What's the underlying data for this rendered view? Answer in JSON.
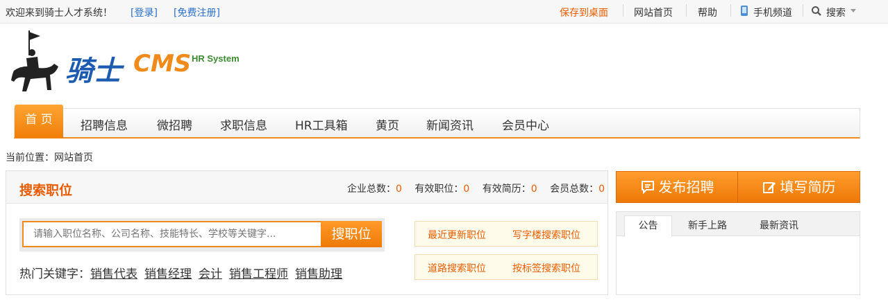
{
  "topbar": {
    "welcome": "欢迎来到骑士人才系统！",
    "login": "[登录]",
    "register": "[免费注册]",
    "save_desktop": "保存到桌面",
    "home": "网站首页",
    "help": "帮助",
    "mobile": "手机频道",
    "search": "搜索"
  },
  "logo": {
    "brand": "骑士",
    "brand_cms": "CMS",
    "tagline": "HR System"
  },
  "nav": {
    "items": [
      "首 页",
      "招聘信息",
      "微招聘",
      "求职信息",
      "HR工具箱",
      "黄页",
      "新闻资讯",
      "会员中心"
    ]
  },
  "breadcrumb": "当前位置：网站首页",
  "search_panel": {
    "title": "搜索职位",
    "stats": [
      {
        "label": "企业总数：",
        "value": "0"
      },
      {
        "label": "有效职位：",
        "value": "0"
      },
      {
        "label": "有效简历：",
        "value": "0"
      },
      {
        "label": "会员总数：",
        "value": "0"
      }
    ],
    "placeholder": "请输入职位名称、公司名称、技能特长、学校等关键字...",
    "button": "搜职位",
    "hot_label": "热门关键字：",
    "hot_keywords": [
      "销售代表",
      "销售经理",
      "会计",
      "销售工程师",
      "销售助理"
    ],
    "quick_links": [
      "最近更新职位",
      "写字楼搜索职位",
      "道路搜索职位",
      "按标签搜索职位"
    ]
  },
  "actions": {
    "publish": "发布招聘",
    "resume": "填写简历"
  },
  "notice": {
    "tabs": [
      "公告",
      "新手上路",
      "最新资讯"
    ]
  },
  "colors": {
    "accent": "#f08a1a",
    "link": "#2a6fc9",
    "highlight": "#e65c00"
  }
}
